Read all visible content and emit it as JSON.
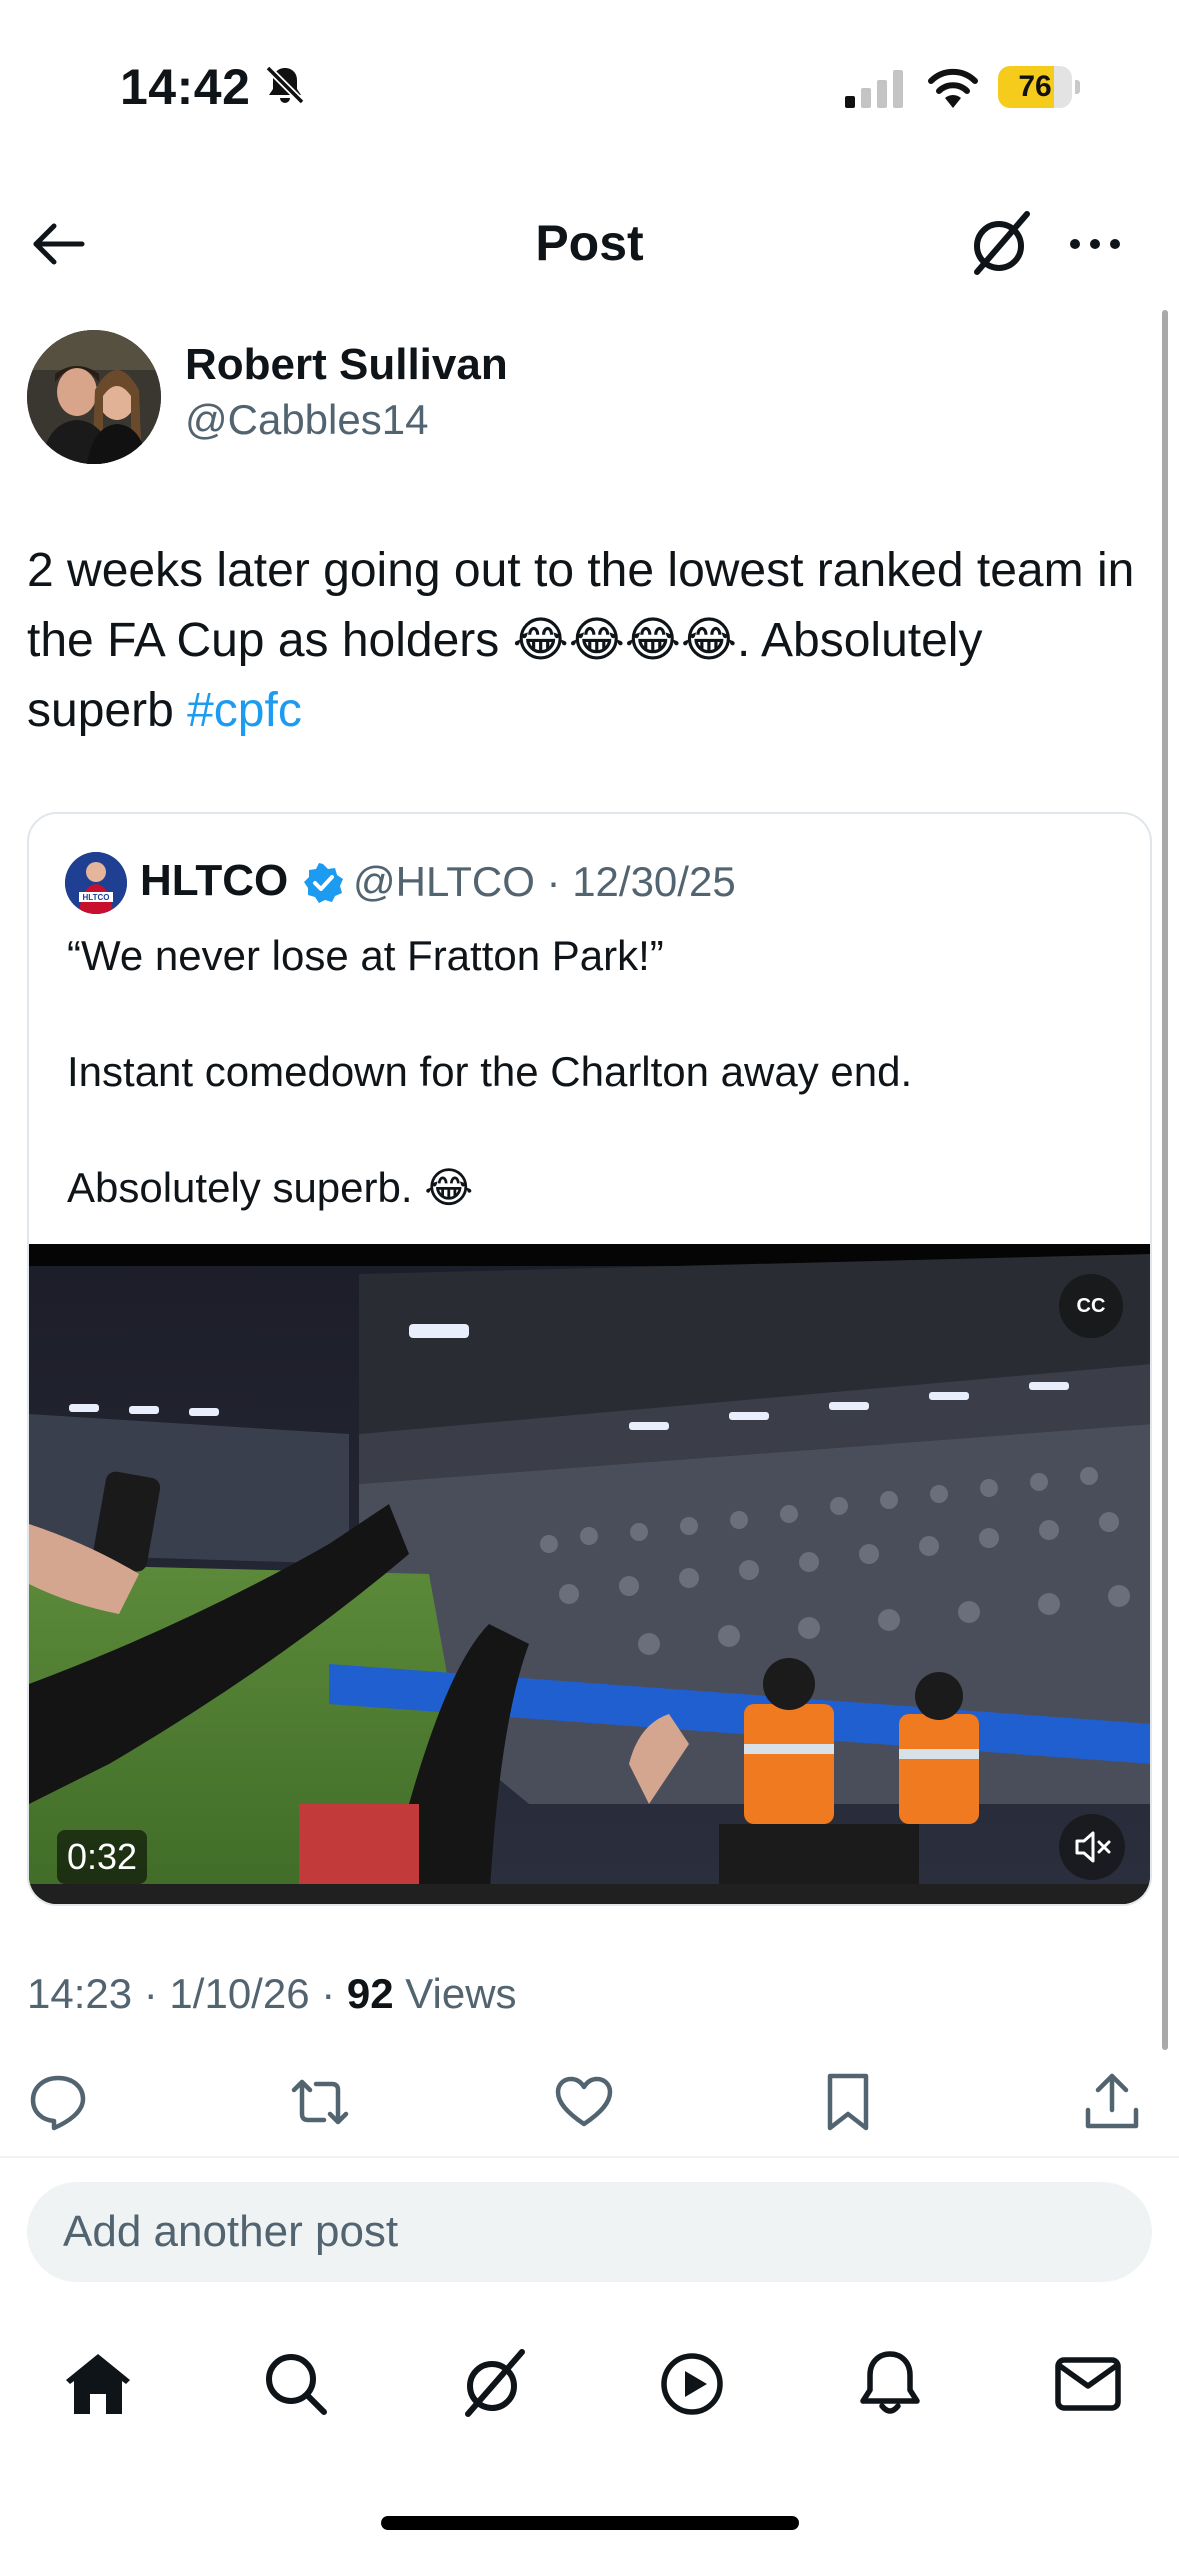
{
  "status_bar": {
    "time": "14:42",
    "battery": "76",
    "battery_level": 0.76
  },
  "header": {
    "title": "Post"
  },
  "post": {
    "author_name": "Robert Sullivan",
    "author_handle": "@Cabbles14",
    "text_part1": "2 weeks later going out to the lowest ranked team in the FA Cup as holders 😂😂😂😂. Absolutely superb ",
    "hashtag": "#cpfc",
    "timestamp": "14:23 · 1/10/26 · ",
    "views_count": "92",
    "views_label": " Views"
  },
  "quote": {
    "name": "HLTCO",
    "meta": "@HLTCO · 12/30/25",
    "line1": "“We never lose at Fratton Park!”",
    "line2": "Instant comedown for the Charlton away end.",
    "line3": "Absolutely superb. 😂",
    "video_duration": "0:32",
    "cc_label": "CC"
  },
  "reply": {
    "placeholder": "Add another post"
  },
  "colors": {
    "accent": "#1d9bf0",
    "secondary_text": "#536471",
    "battery": "#f6cc1c"
  },
  "icons": {
    "actions": [
      "reply-icon",
      "repost-icon",
      "like-icon",
      "bookmark-icon",
      "share-icon"
    ],
    "tabs": [
      "home-icon",
      "search-icon",
      "grok-icon",
      "video-icon",
      "notifications-icon",
      "messages-icon"
    ]
  }
}
